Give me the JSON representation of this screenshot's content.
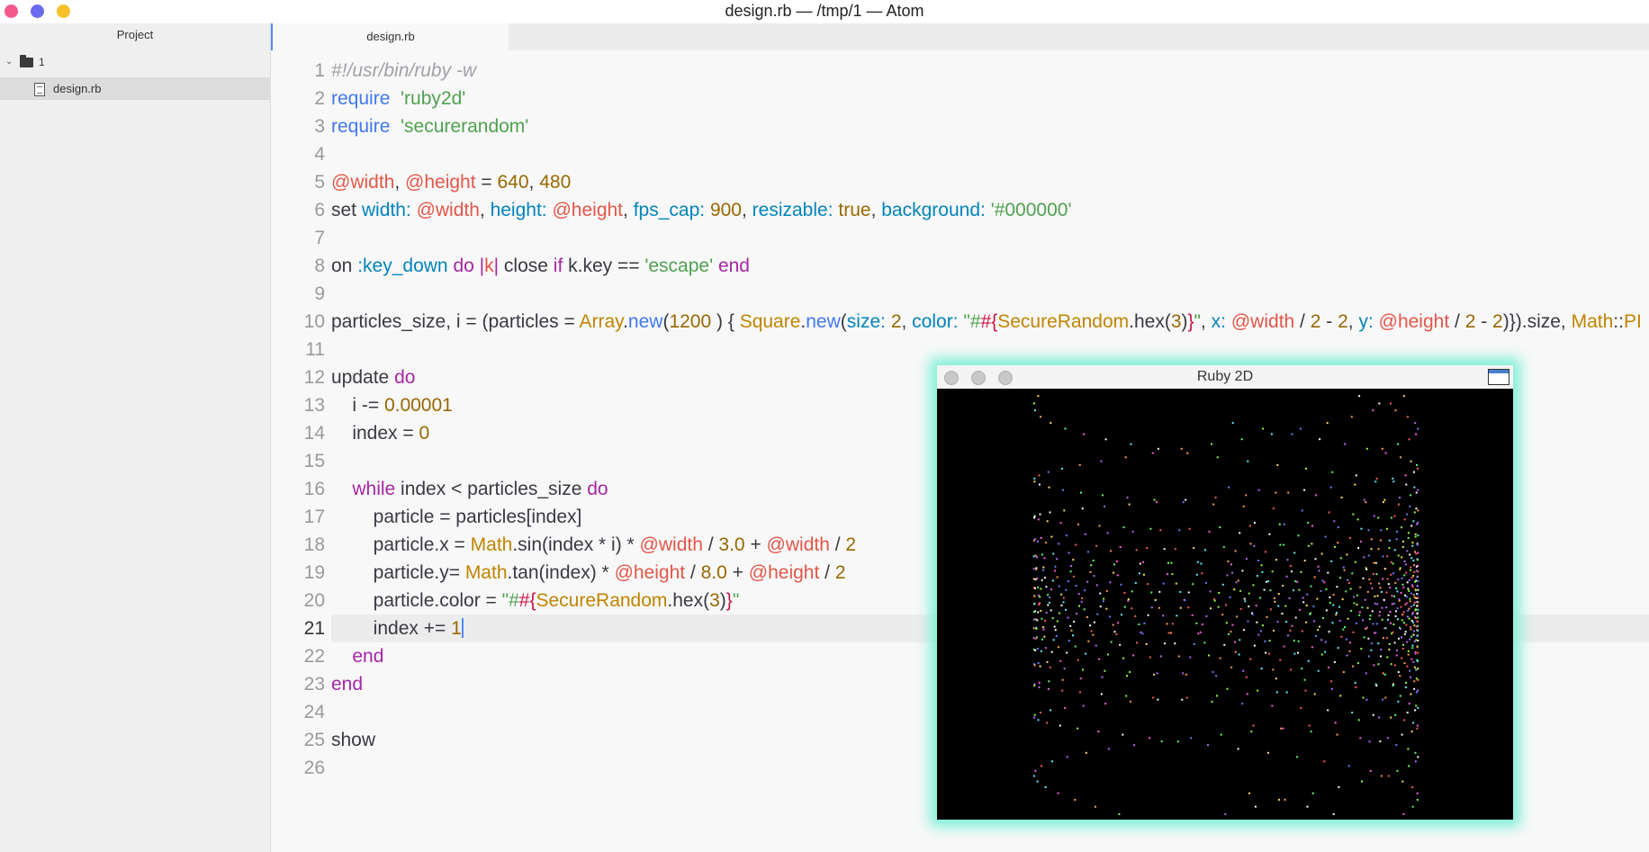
{
  "window": {
    "title": "design.rb — /tmp/1 — Atom"
  },
  "sidebar": {
    "header": "Project",
    "root_folder": "1",
    "files": [
      "design.rb"
    ]
  },
  "editor": {
    "active_tab": "design.rb",
    "cursor_line": 21,
    "lines": [
      [
        [
          "c-com",
          "#!/usr/bin/ruby -w"
        ]
      ],
      [
        [
          "c-fn",
          "require"
        ],
        [
          "",
          "  "
        ],
        [
          "c-str",
          "'ruby2d'"
        ]
      ],
      [
        [
          "c-fn",
          "require"
        ],
        [
          "",
          "  "
        ],
        [
          "c-str",
          "'securerandom'"
        ]
      ],
      [],
      [
        [
          "c-ivar",
          "@width"
        ],
        [
          "",
          ", "
        ],
        [
          "c-ivar",
          "@height"
        ],
        [
          "",
          " = "
        ],
        [
          "c-num",
          "640"
        ],
        [
          "",
          ", "
        ],
        [
          "c-num",
          "480"
        ]
      ],
      [
        [
          "",
          "set "
        ],
        [
          "c-sym",
          "width:"
        ],
        [
          "",
          " "
        ],
        [
          "c-ivar",
          "@width"
        ],
        [
          "",
          ", "
        ],
        [
          "c-sym",
          "height:"
        ],
        [
          "",
          " "
        ],
        [
          "c-ivar",
          "@height"
        ],
        [
          "",
          ", "
        ],
        [
          "c-sym",
          "fps_cap:"
        ],
        [
          "",
          " "
        ],
        [
          "c-num",
          "900"
        ],
        [
          "",
          ", "
        ],
        [
          "c-sym",
          "resizable:"
        ],
        [
          "",
          " "
        ],
        [
          "c-num",
          "true"
        ],
        [
          "",
          ", "
        ],
        [
          "c-sym",
          "background:"
        ],
        [
          "",
          " "
        ],
        [
          "c-str",
          "'#000000'"
        ]
      ],
      [],
      [
        [
          "",
          "on "
        ],
        [
          "c-sym",
          ":key_down"
        ],
        [
          "",
          " "
        ],
        [
          "c-kw",
          "do"
        ],
        [
          "",
          " "
        ],
        [
          "c-kw",
          "|"
        ],
        [
          "c-ivar",
          "k"
        ],
        [
          "c-kw",
          "|"
        ],
        [
          "",
          " close "
        ],
        [
          "c-kw",
          "if"
        ],
        [
          "",
          " k.key == "
        ],
        [
          "c-str",
          "'escape'"
        ],
        [
          "",
          " "
        ],
        [
          "c-kw",
          "end"
        ]
      ],
      [],
      [
        [
          "",
          "particles_size, i = (particles = "
        ],
        [
          "c-cls",
          "Array"
        ],
        [
          "",
          "."
        ],
        [
          "c-fn",
          "new"
        ],
        [
          "",
          "("
        ],
        [
          "c-num",
          "1200"
        ],
        [
          "",
          " ) { "
        ],
        [
          "c-cls",
          "Square"
        ],
        [
          "",
          "."
        ],
        [
          "c-fn",
          "new"
        ],
        [
          "",
          "("
        ],
        [
          "c-sym",
          "size:"
        ],
        [
          "",
          " "
        ],
        [
          "c-num",
          "2"
        ],
        [
          "",
          ", "
        ],
        [
          "c-sym",
          "color:"
        ],
        [
          "",
          " "
        ],
        [
          "c-str",
          "\"#"
        ],
        [
          "c-esc",
          "#{"
        ],
        [
          "c-cls",
          "SecureRandom"
        ],
        [
          "",
          ".hex("
        ],
        [
          "c-num",
          "3"
        ],
        [
          "",
          ")"
        ],
        [
          "c-esc",
          "}"
        ],
        [
          "c-str",
          "\""
        ],
        [
          "",
          ", "
        ],
        [
          "c-sym",
          "x:"
        ],
        [
          "",
          " "
        ],
        [
          "c-ivar",
          "@width"
        ],
        [
          "",
          " / "
        ],
        [
          "c-num",
          "2"
        ],
        [
          "",
          " - "
        ],
        [
          "c-num",
          "2"
        ],
        [
          "",
          ", "
        ],
        [
          "c-sym",
          "y:"
        ],
        [
          "",
          " "
        ],
        [
          "c-ivar",
          "@height"
        ],
        [
          "",
          " / "
        ],
        [
          "c-num",
          "2"
        ],
        [
          "",
          " - "
        ],
        [
          "c-num",
          "2"
        ],
        [
          "",
          ")}).size, "
        ],
        [
          "c-cls",
          "Math"
        ],
        [
          "",
          "::"
        ],
        [
          "c-cls",
          "PI"
        ]
      ],
      [],
      [
        [
          "",
          "update "
        ],
        [
          "c-kw",
          "do"
        ]
      ],
      [
        [
          "",
          "    i -= "
        ],
        [
          "c-num",
          "0.00001"
        ]
      ],
      [
        [
          "",
          "    index = "
        ],
        [
          "c-num",
          "0"
        ]
      ],
      [],
      [
        [
          "",
          "    "
        ],
        [
          "c-kw",
          "while"
        ],
        [
          "",
          " index < particles_size "
        ],
        [
          "c-kw",
          "do"
        ]
      ],
      [
        [
          "",
          "        particle = particles[index]"
        ]
      ],
      [
        [
          "",
          "        particle.x = "
        ],
        [
          "c-cls",
          "Math"
        ],
        [
          "",
          ".sin(index * i) * "
        ],
        [
          "c-ivar",
          "@width"
        ],
        [
          "",
          " / "
        ],
        [
          "c-num",
          "3.0"
        ],
        [
          "",
          " + "
        ],
        [
          "c-ivar",
          "@width"
        ],
        [
          "",
          " / "
        ],
        [
          "c-num",
          "2"
        ]
      ],
      [
        [
          "",
          "        particle.y= "
        ],
        [
          "c-cls",
          "Math"
        ],
        [
          "",
          ".tan(index) * "
        ],
        [
          "c-ivar",
          "@height"
        ],
        [
          "",
          " / "
        ],
        [
          "c-num",
          "8.0"
        ],
        [
          "",
          " + "
        ],
        [
          "c-ivar",
          "@height"
        ],
        [
          "",
          " / "
        ],
        [
          "c-num",
          "2"
        ]
      ],
      [
        [
          "",
          "        particle.color = "
        ],
        [
          "c-str",
          "\"#"
        ],
        [
          "c-esc",
          "#{"
        ],
        [
          "c-cls",
          "SecureRandom"
        ],
        [
          "",
          ".hex("
        ],
        [
          "c-num",
          "3"
        ],
        [
          "",
          ")"
        ],
        [
          "c-esc",
          "}"
        ],
        [
          "c-str",
          "\""
        ]
      ],
      [
        [
          "",
          "        index += "
        ],
        [
          "c-num",
          "1"
        ]
      ],
      [
        [
          "",
          "    "
        ],
        [
          "c-kw",
          "end"
        ]
      ],
      [
        [
          "c-kw",
          "end"
        ]
      ],
      [],
      [
        [
          "",
          "show"
        ]
      ],
      []
    ]
  },
  "ruby_window": {
    "title": "Ruby 2D",
    "particle_colors": [
      "#ff5a5a",
      "#5aff6a",
      "#6a7dff",
      "#ffe15a",
      "#ff5ae1",
      "#5af0ff",
      "#ffffff",
      "#ffa04a",
      "#b46aff",
      "#8aff3a"
    ]
  }
}
